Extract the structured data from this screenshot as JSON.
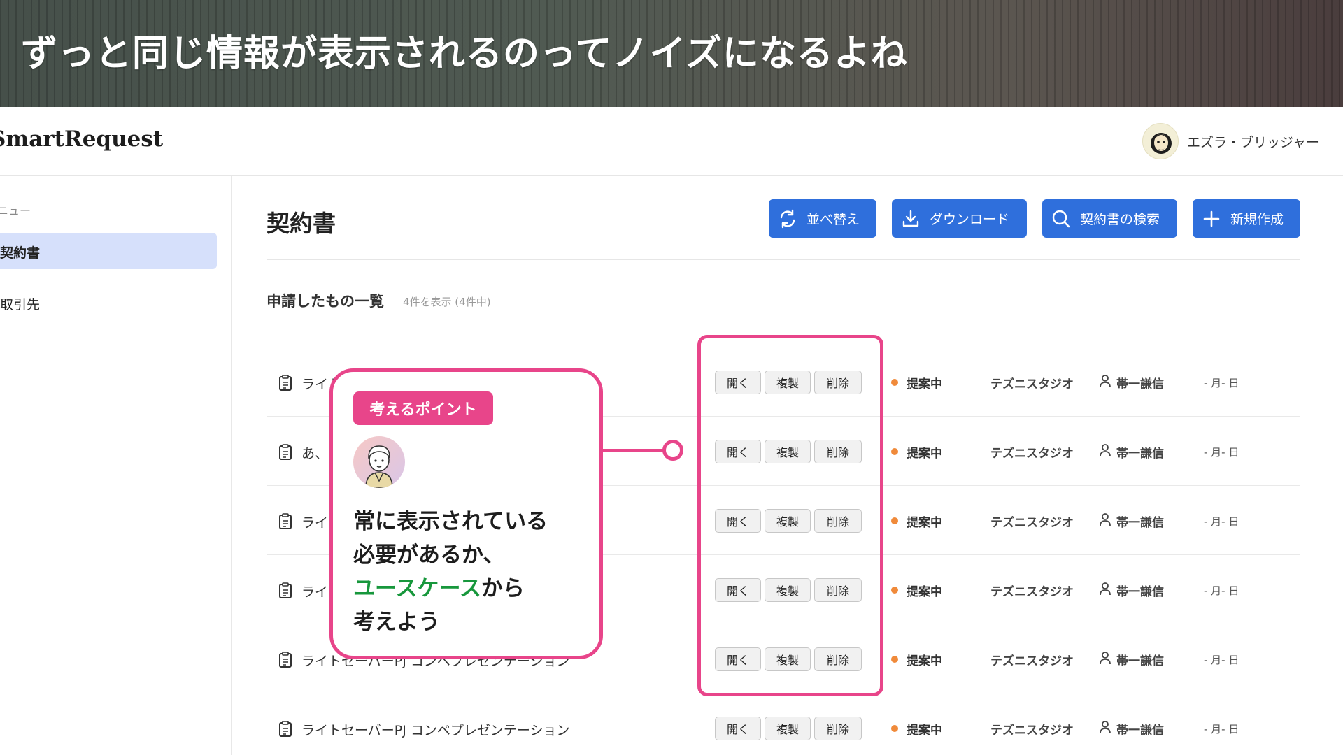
{
  "banner": {
    "title": "ずっと同じ情報が表示されるのってノイズになるよね"
  },
  "app": {
    "logo": "SmartRequest",
    "user_name": "エズラ・ブリッジャー"
  },
  "sidebar": {
    "heading": "ニュー",
    "items": [
      {
        "label": "契約書",
        "active": true
      },
      {
        "label": "取引先",
        "active": false
      }
    ]
  },
  "main": {
    "title": "契約書",
    "toolbar": [
      {
        "label": "並べ替え",
        "icon": "sort-refresh-icon"
      },
      {
        "label": "ダウンロード",
        "icon": "download-icon"
      },
      {
        "label": "契約書の検索",
        "icon": "search-icon"
      },
      {
        "label": "新規作成",
        "icon": "plus-icon"
      }
    ],
    "list_title": "申請したもの一覧",
    "list_count": "4件を表示 (4件中)",
    "actions": {
      "open": "開く",
      "copy": "複製",
      "delete": "削除"
    },
    "rows": [
      {
        "name": "ライト",
        "status": "提案中",
        "company": "テズニスタジオ",
        "user": "帯一謙信",
        "date": "- 月- 日"
      },
      {
        "name": "あ、",
        "status": "提案中",
        "company": "テズニスタジオ",
        "user": "帯一謙信",
        "date": "- 月- 日"
      },
      {
        "name": "ライ",
        "status": "提案中",
        "company": "テズニスタジオ",
        "user": "帯一謙信",
        "date": "- 月- 日"
      },
      {
        "name": "ライ",
        "status": "提案中",
        "company": "テズニスタジオ",
        "user": "帯一謙信",
        "date": "- 月- 日"
      },
      {
        "name": "ライトセーバーPJ コンペプレゼンテーション",
        "status": "提案中",
        "company": "テズニスタジオ",
        "user": "帯一謙信",
        "date": "- 月- 日"
      },
      {
        "name": "ライトセーバーPJ コンペプレゼンテーション",
        "status": "提案中",
        "company": "テズニスタジオ",
        "user": "帯一謙信",
        "date": "- 月- 日"
      }
    ]
  },
  "callout": {
    "tag": "考えるポイント",
    "line1": "常に表示されている",
    "line2": "必要があるか、",
    "line3_highlight": "ユースケース",
    "line3_rest": "から",
    "line4": "考えよう"
  },
  "colors": {
    "accent_pink": "#e8458a",
    "primary_blue": "#2f6fdc",
    "sidebar_active": "#d6e0fb",
    "status_orange": "#f08a3a",
    "highlight_green": "#17973c"
  }
}
